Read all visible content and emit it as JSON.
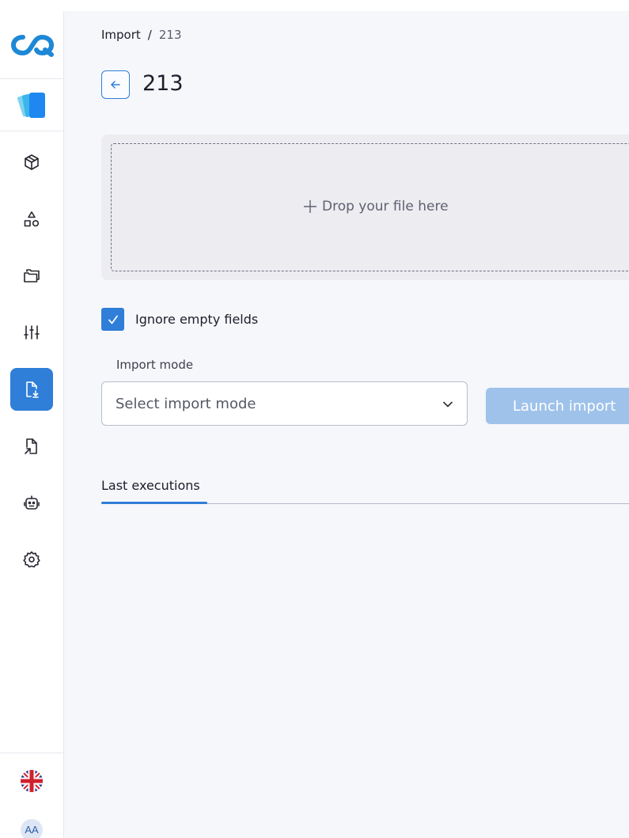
{
  "breadcrumb": {
    "root": "Import",
    "separator": "/",
    "current": "213"
  },
  "page": {
    "title": "213"
  },
  "dropzone": {
    "label": "Drop your file here"
  },
  "options": {
    "ignore_empty_label": "Ignore empty fields",
    "ignore_empty_checked": true
  },
  "import_mode": {
    "label": "Import mode",
    "placeholder": "Select import mode"
  },
  "actions": {
    "launch_label": "Launch import"
  },
  "tabs": [
    {
      "label": "Last executions",
      "active": true
    }
  ],
  "user": {
    "initials": "AA",
    "language": "English (UK)"
  },
  "colors": {
    "accent": "#2f7ed8",
    "accent_disabled": "#9ec2ea",
    "background": "#f6f7fb"
  },
  "sidebar": {
    "items": [
      {
        "icon": "cube-icon",
        "active": false
      },
      {
        "icon": "shapes-icon",
        "active": false
      },
      {
        "icon": "folders-icon",
        "active": false
      },
      {
        "icon": "sliders-icon",
        "active": false
      },
      {
        "icon": "file-import-icon",
        "active": true
      },
      {
        "icon": "file-export-icon",
        "active": false
      },
      {
        "icon": "robot-icon",
        "active": false
      },
      {
        "icon": "gear-icon",
        "active": false
      }
    ]
  }
}
